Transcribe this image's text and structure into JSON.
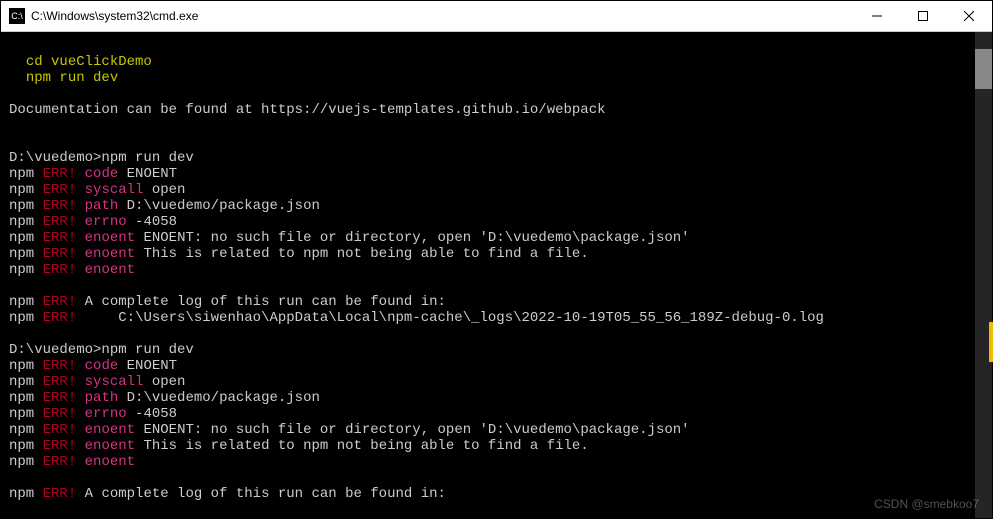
{
  "titlebar": {
    "icon_label": "C:\\",
    "title": "C:\\Windows\\system32\\cmd.exe"
  },
  "terminal": {
    "pad1": "  ",
    "cmd1": "cd vueClickDemo",
    "cmd2": "npm run dev",
    "blank": "",
    "doc_line": "Documentation can be found at https://vuejs-templates.github.io/webpack",
    "prompt1": "D:\\vuedemo>npm run dev",
    "npm": "npm",
    "sp": " ",
    "err": "ERR!",
    "code_label": "code",
    "code_val": " ENOENT",
    "syscall_label": "syscall",
    "syscall_val": " open",
    "path_label": "path",
    "path_val": " D:\\vuedemo/package.json",
    "errno_label": "errno",
    "errno_val": " -4058",
    "enoent_label": "enoent",
    "enoent_msg1": " ENOENT: no such file or directory, open 'D:\\vuedemo\\package.json'",
    "enoent_msg2": " This is related to npm not being able to find a file.",
    "log_line1": " A complete log of this run can be found in:",
    "log_line2": "     C:\\Users\\siwenhao\\AppData\\Local\\npm-cache\\_logs\\2022-10-19T05_55_56_189Z-debug-0.log"
  },
  "watermark": "CSDN @smebkoo7"
}
